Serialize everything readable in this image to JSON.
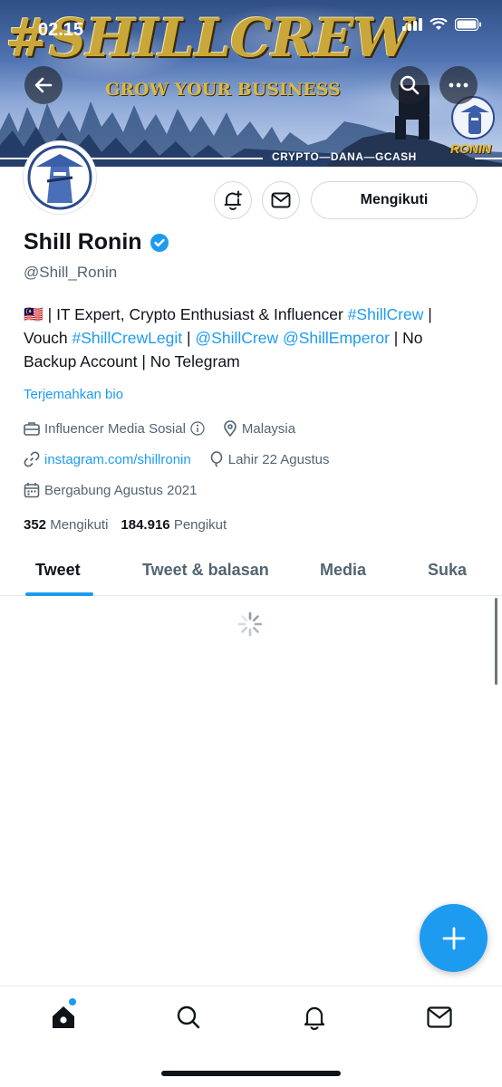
{
  "status_bar": {
    "time": "02.15"
  },
  "banner": {
    "title": "#SHILLCREW",
    "subtitle": "GROW YOUR BUSINESS",
    "strip": "CRYPTO—DANA—GCASH",
    "badge_word": "RONIN"
  },
  "profile": {
    "name": "Shill Ronin",
    "handle": "@Shill_Ronin",
    "verified": true,
    "follow_label": "Mengikuti",
    "bio": {
      "flag": "🇲🇾",
      "part1": " | IT Expert, Crypto Enthusiast & Influencer ",
      "tag1": "#ShillCrew",
      "part2": " | Vouch ",
      "tag2": "#ShillCrewLegit",
      "part3": " | ",
      "mention1": "@ShillCrew",
      "part4": " ",
      "mention2": "@ShillEmperor",
      "part5": " | No Backup Account | No Telegram"
    },
    "translate_label": "Terjemahkan bio",
    "category": "Influencer Media Sosial",
    "location": "Malaysia",
    "website": "instagram.com/shillronin",
    "birthday": "Lahir 22 Agustus",
    "joined": "Bergabung Agustus 2021",
    "following_count": "352",
    "following_label": "Mengikuti",
    "followers_count": "184.916",
    "followers_label": "Pengikut"
  },
  "tabs": [
    {
      "label": "Tweet"
    },
    {
      "label": "Tweet & balasan"
    },
    {
      "label": "Media"
    },
    {
      "label": "Suka"
    }
  ],
  "colors": {
    "accent": "#1d9bf0",
    "text": "#0f1419",
    "secondary": "#536471"
  },
  "icons": {
    "back": "arrow-left-icon",
    "search": "search-icon",
    "more": "more-icon",
    "notify": "bell-plus-icon",
    "message": "envelope-icon",
    "compose": "plus-icon"
  }
}
